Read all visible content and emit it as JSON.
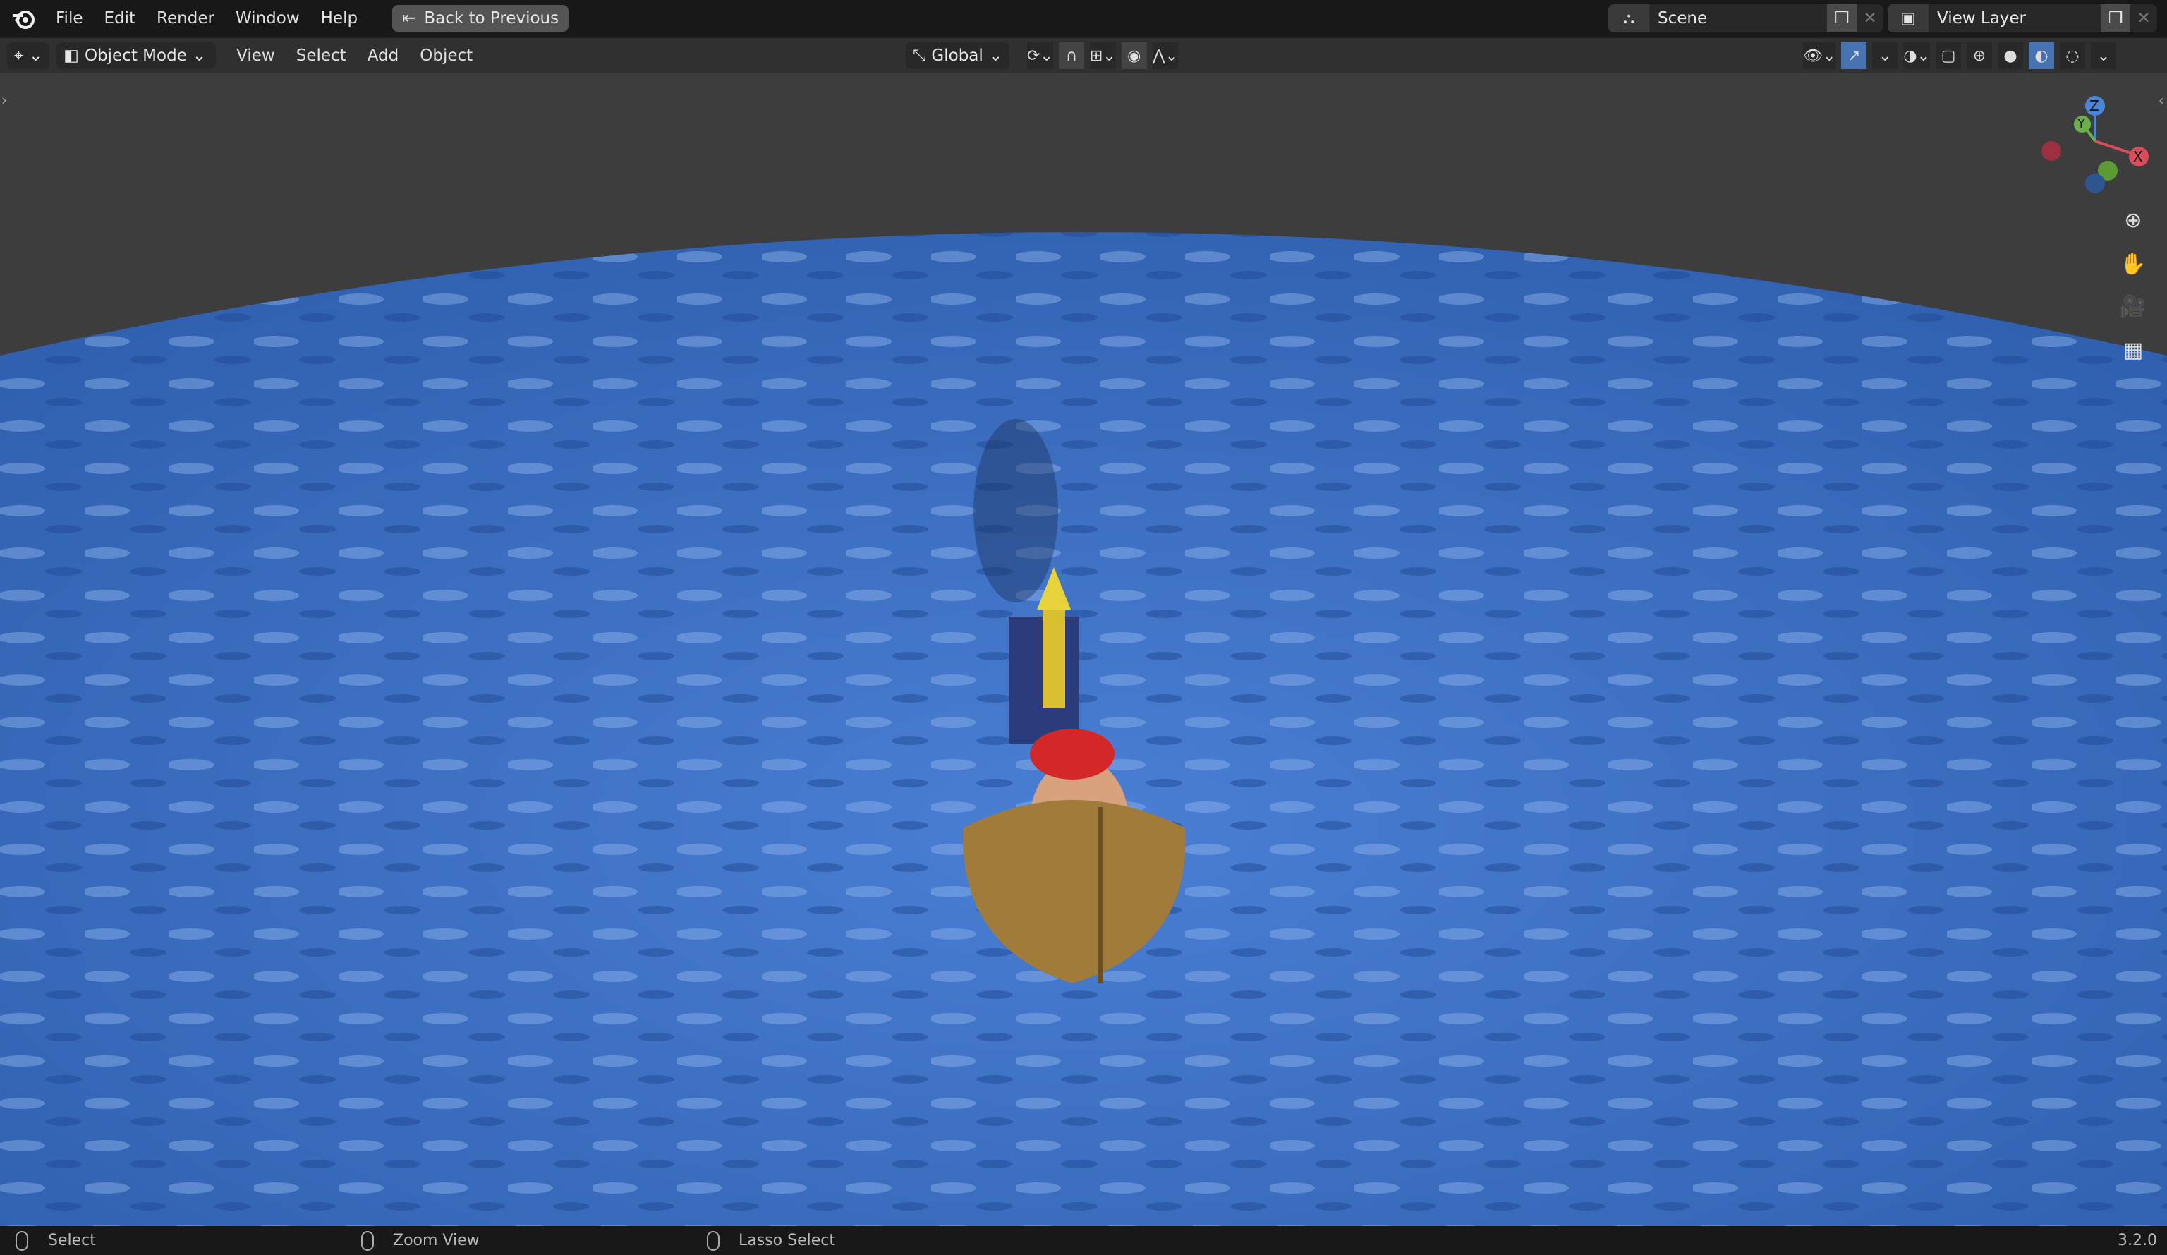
{
  "topbar": {
    "menus": [
      "File",
      "Edit",
      "Render",
      "Window",
      "Help"
    ],
    "back_button": "Back to Previous",
    "scene": "Scene",
    "view_layer": "View Layer"
  },
  "header": {
    "mode": "Object Mode",
    "menus": [
      "View",
      "Select",
      "Add",
      "Object"
    ],
    "orientation": "Global"
  },
  "gizmo": {
    "x": "X",
    "y": "Y",
    "z": "Z"
  },
  "status": {
    "select": "Select",
    "zoom": "Zoom View",
    "lasso": "Lasso Select",
    "version": "3.2.0"
  },
  "colors": {
    "accent": "#4772b3",
    "water": "#3d6fc4"
  }
}
